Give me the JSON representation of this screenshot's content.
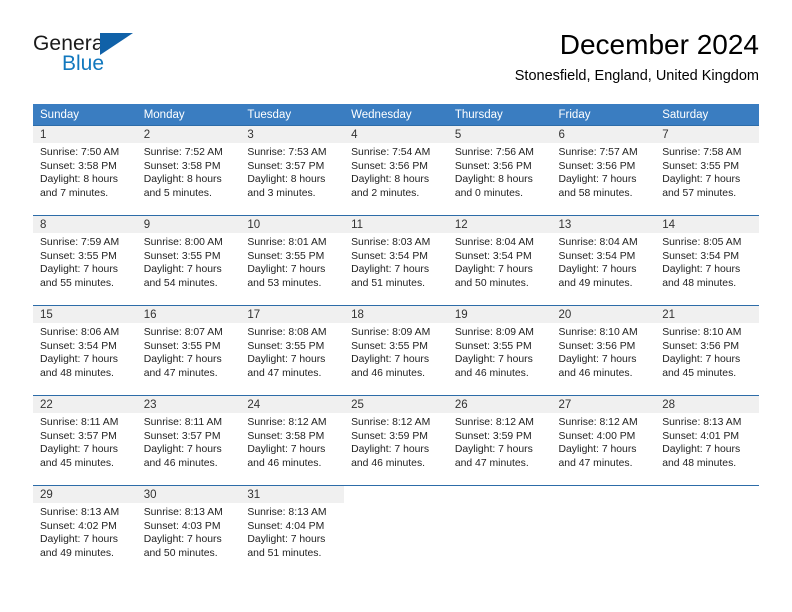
{
  "brand": {
    "name_part1": "General",
    "name_part2": "Blue",
    "triangle_icon": "triangle-icon",
    "color_primary": "#1061a8",
    "color_secondary": "#1278be"
  },
  "header": {
    "title": "December 2024",
    "subtitle": "Stonesfield, England, United Kingdom"
  },
  "theme": {
    "header_bg": "#3a7dc1",
    "daynum_bg": "#f0f0f0",
    "grid_line": "#2d6ca8"
  },
  "weekdays": [
    "Sunday",
    "Monday",
    "Tuesday",
    "Wednesday",
    "Thursday",
    "Friday",
    "Saturday"
  ],
  "weeks": [
    [
      {
        "day": "1",
        "sunrise": "Sunrise: 7:50 AM",
        "sunset": "Sunset: 3:58 PM",
        "daylight1": "Daylight: 8 hours",
        "daylight2": "and 7 minutes."
      },
      {
        "day": "2",
        "sunrise": "Sunrise: 7:52 AM",
        "sunset": "Sunset: 3:58 PM",
        "daylight1": "Daylight: 8 hours",
        "daylight2": "and 5 minutes."
      },
      {
        "day": "3",
        "sunrise": "Sunrise: 7:53 AM",
        "sunset": "Sunset: 3:57 PM",
        "daylight1": "Daylight: 8 hours",
        "daylight2": "and 3 minutes."
      },
      {
        "day": "4",
        "sunrise": "Sunrise: 7:54 AM",
        "sunset": "Sunset: 3:56 PM",
        "daylight1": "Daylight: 8 hours",
        "daylight2": "and 2 minutes."
      },
      {
        "day": "5",
        "sunrise": "Sunrise: 7:56 AM",
        "sunset": "Sunset: 3:56 PM",
        "daylight1": "Daylight: 8 hours",
        "daylight2": "and 0 minutes."
      },
      {
        "day": "6",
        "sunrise": "Sunrise: 7:57 AM",
        "sunset": "Sunset: 3:56 PM",
        "daylight1": "Daylight: 7 hours",
        "daylight2": "and 58 minutes."
      },
      {
        "day": "7",
        "sunrise": "Sunrise: 7:58 AM",
        "sunset": "Sunset: 3:55 PM",
        "daylight1": "Daylight: 7 hours",
        "daylight2": "and 57 minutes."
      }
    ],
    [
      {
        "day": "8",
        "sunrise": "Sunrise: 7:59 AM",
        "sunset": "Sunset: 3:55 PM",
        "daylight1": "Daylight: 7 hours",
        "daylight2": "and 55 minutes."
      },
      {
        "day": "9",
        "sunrise": "Sunrise: 8:00 AM",
        "sunset": "Sunset: 3:55 PM",
        "daylight1": "Daylight: 7 hours",
        "daylight2": "and 54 minutes."
      },
      {
        "day": "10",
        "sunrise": "Sunrise: 8:01 AM",
        "sunset": "Sunset: 3:55 PM",
        "daylight1": "Daylight: 7 hours",
        "daylight2": "and 53 minutes."
      },
      {
        "day": "11",
        "sunrise": "Sunrise: 8:03 AM",
        "sunset": "Sunset: 3:54 PM",
        "daylight1": "Daylight: 7 hours",
        "daylight2": "and 51 minutes."
      },
      {
        "day": "12",
        "sunrise": "Sunrise: 8:04 AM",
        "sunset": "Sunset: 3:54 PM",
        "daylight1": "Daylight: 7 hours",
        "daylight2": "and 50 minutes."
      },
      {
        "day": "13",
        "sunrise": "Sunrise: 8:04 AM",
        "sunset": "Sunset: 3:54 PM",
        "daylight1": "Daylight: 7 hours",
        "daylight2": "and 49 minutes."
      },
      {
        "day": "14",
        "sunrise": "Sunrise: 8:05 AM",
        "sunset": "Sunset: 3:54 PM",
        "daylight1": "Daylight: 7 hours",
        "daylight2": "and 48 minutes."
      }
    ],
    [
      {
        "day": "15",
        "sunrise": "Sunrise: 8:06 AM",
        "sunset": "Sunset: 3:54 PM",
        "daylight1": "Daylight: 7 hours",
        "daylight2": "and 48 minutes."
      },
      {
        "day": "16",
        "sunrise": "Sunrise: 8:07 AM",
        "sunset": "Sunset: 3:55 PM",
        "daylight1": "Daylight: 7 hours",
        "daylight2": "and 47 minutes."
      },
      {
        "day": "17",
        "sunrise": "Sunrise: 8:08 AM",
        "sunset": "Sunset: 3:55 PM",
        "daylight1": "Daylight: 7 hours",
        "daylight2": "and 47 minutes."
      },
      {
        "day": "18",
        "sunrise": "Sunrise: 8:09 AM",
        "sunset": "Sunset: 3:55 PM",
        "daylight1": "Daylight: 7 hours",
        "daylight2": "and 46 minutes."
      },
      {
        "day": "19",
        "sunrise": "Sunrise: 8:09 AM",
        "sunset": "Sunset: 3:55 PM",
        "daylight1": "Daylight: 7 hours",
        "daylight2": "and 46 minutes."
      },
      {
        "day": "20",
        "sunrise": "Sunrise: 8:10 AM",
        "sunset": "Sunset: 3:56 PM",
        "daylight1": "Daylight: 7 hours",
        "daylight2": "and 46 minutes."
      },
      {
        "day": "21",
        "sunrise": "Sunrise: 8:10 AM",
        "sunset": "Sunset: 3:56 PM",
        "daylight1": "Daylight: 7 hours",
        "daylight2": "and 45 minutes."
      }
    ],
    [
      {
        "day": "22",
        "sunrise": "Sunrise: 8:11 AM",
        "sunset": "Sunset: 3:57 PM",
        "daylight1": "Daylight: 7 hours",
        "daylight2": "and 45 minutes."
      },
      {
        "day": "23",
        "sunrise": "Sunrise: 8:11 AM",
        "sunset": "Sunset: 3:57 PM",
        "daylight1": "Daylight: 7 hours",
        "daylight2": "and 46 minutes."
      },
      {
        "day": "24",
        "sunrise": "Sunrise: 8:12 AM",
        "sunset": "Sunset: 3:58 PM",
        "daylight1": "Daylight: 7 hours",
        "daylight2": "and 46 minutes."
      },
      {
        "day": "25",
        "sunrise": "Sunrise: 8:12 AM",
        "sunset": "Sunset: 3:59 PM",
        "daylight1": "Daylight: 7 hours",
        "daylight2": "and 46 minutes."
      },
      {
        "day": "26",
        "sunrise": "Sunrise: 8:12 AM",
        "sunset": "Sunset: 3:59 PM",
        "daylight1": "Daylight: 7 hours",
        "daylight2": "and 47 minutes."
      },
      {
        "day": "27",
        "sunrise": "Sunrise: 8:12 AM",
        "sunset": "Sunset: 4:00 PM",
        "daylight1": "Daylight: 7 hours",
        "daylight2": "and 47 minutes."
      },
      {
        "day": "28",
        "sunrise": "Sunrise: 8:13 AM",
        "sunset": "Sunset: 4:01 PM",
        "daylight1": "Daylight: 7 hours",
        "daylight2": "and 48 minutes."
      }
    ],
    [
      {
        "day": "29",
        "sunrise": "Sunrise: 8:13 AM",
        "sunset": "Sunset: 4:02 PM",
        "daylight1": "Daylight: 7 hours",
        "daylight2": "and 49 minutes."
      },
      {
        "day": "30",
        "sunrise": "Sunrise: 8:13 AM",
        "sunset": "Sunset: 4:03 PM",
        "daylight1": "Daylight: 7 hours",
        "daylight2": "and 50 minutes."
      },
      {
        "day": "31",
        "sunrise": "Sunrise: 8:13 AM",
        "sunset": "Sunset: 4:04 PM",
        "daylight1": "Daylight: 7 hours",
        "daylight2": "and 51 minutes."
      },
      {
        "day": "",
        "sunrise": "",
        "sunset": "",
        "daylight1": "",
        "daylight2": ""
      },
      {
        "day": "",
        "sunrise": "",
        "sunset": "",
        "daylight1": "",
        "daylight2": ""
      },
      {
        "day": "",
        "sunrise": "",
        "sunset": "",
        "daylight1": "",
        "daylight2": ""
      },
      {
        "day": "",
        "sunrise": "",
        "sunset": "",
        "daylight1": "",
        "daylight2": ""
      }
    ]
  ]
}
